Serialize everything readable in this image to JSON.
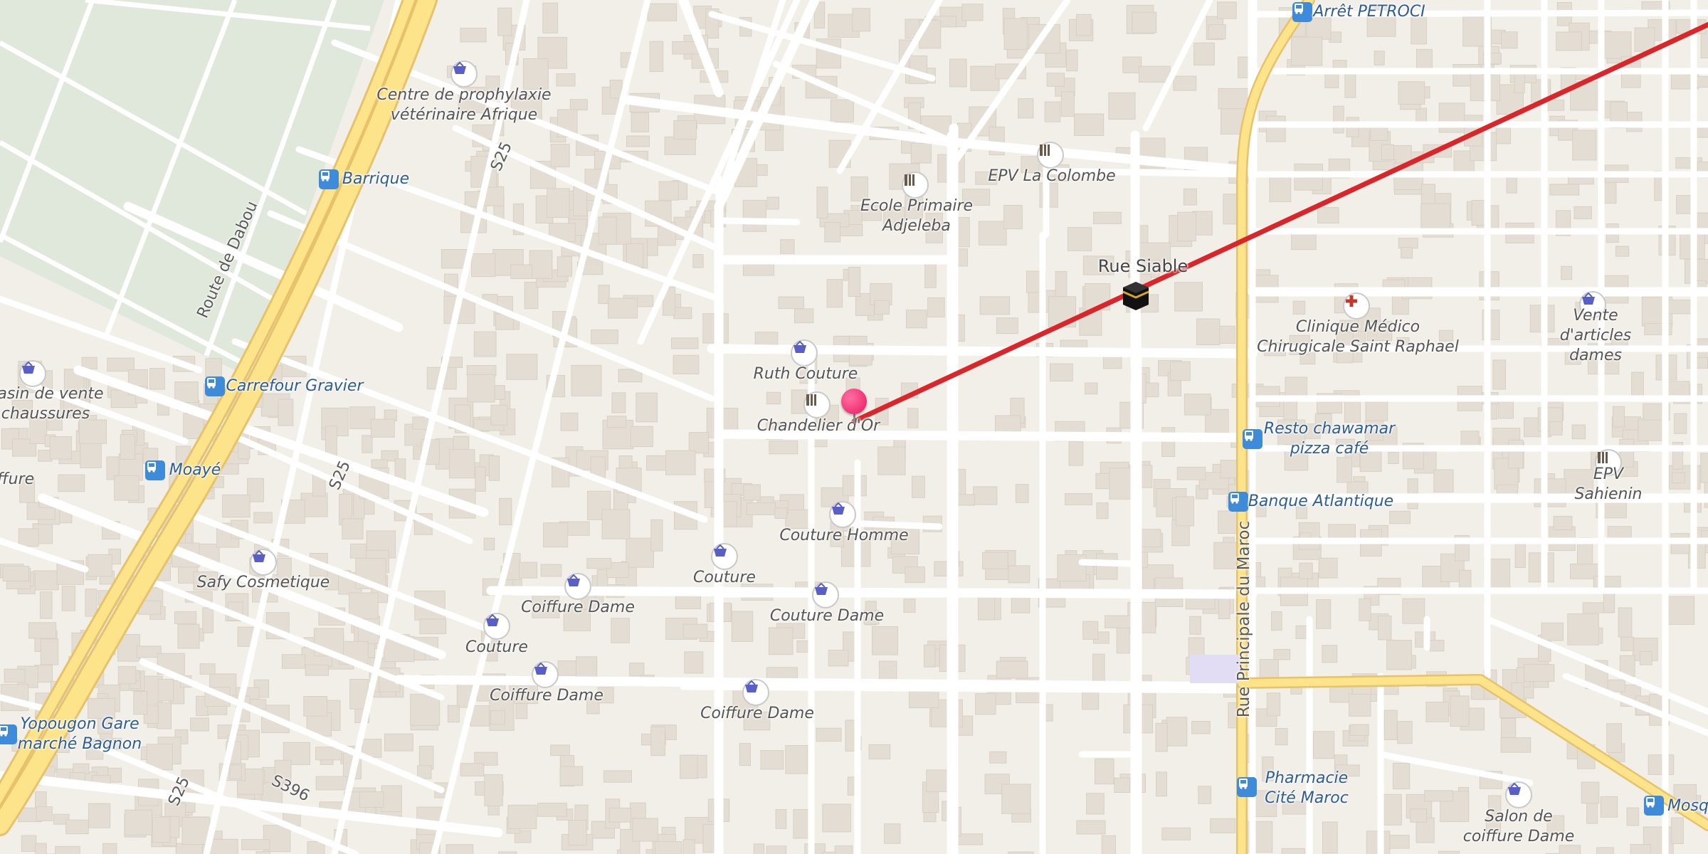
{
  "map": {
    "route_color": "#d9262b",
    "road_labels": [
      {
        "text": "Route de Dabou",
        "icon": "road-label"
      },
      {
        "text": "Rue Principale du Maroc",
        "icon": "road-label"
      },
      {
        "text": "S25",
        "icon": "road-label"
      },
      {
        "text": "S25",
        "icon": "road-label"
      },
      {
        "text": "S25",
        "icon": "road-label"
      },
      {
        "text": "S396",
        "icon": "road-label"
      }
    ],
    "pois": [
      {
        "label": "Centre de prophylaxie\nvétérinaire Afrique",
        "icon": "shop-basket-icon"
      },
      {
        "label": "Barrique",
        "icon": "bus-stop-icon"
      },
      {
        "label": "Carrefour Gravier",
        "icon": "bus-stop-icon"
      },
      {
        "label": "Moayé",
        "icon": "bus-stop-icon"
      },
      {
        "label": "gasin de vente\nchaussures",
        "icon": "shop-basket-icon"
      },
      {
        "label": "ffure",
        "icon": "shop-basket-icon"
      },
      {
        "label": "Safy Cosmetique",
        "icon": "shop-basket-icon"
      },
      {
        "label": "Yopougon Gare\nmarché Bagnon",
        "icon": "bus-stop-icon"
      },
      {
        "label": "Coiffure Dame",
        "icon": "shop-basket-icon"
      },
      {
        "label": "Couture",
        "icon": "shop-basket-icon"
      },
      {
        "label": "Coiffure Dame",
        "icon": "shop-basket-icon"
      },
      {
        "label": "Couture",
        "icon": "shop-basket-icon"
      },
      {
        "label": "Coiffure Dame",
        "icon": "shop-basket-icon"
      },
      {
        "label": "Couture Dame",
        "icon": "shop-basket-icon"
      },
      {
        "label": "Couture Homme",
        "icon": "shop-basket-icon"
      },
      {
        "label": "Ruth Couture",
        "icon": "shop-basket-icon"
      },
      {
        "label": "Chandelier d'Or",
        "icon": "school-icon"
      },
      {
        "label": "Ecole Primaire\nAdjeleba",
        "icon": "school-icon"
      },
      {
        "label": "EPV La Colombe",
        "icon": "school-icon"
      },
      {
        "label": "Rue Siable",
        "icon": "mosque-kaaba-icon"
      },
      {
        "label": "Arrêt PETROCI",
        "icon": "bus-stop-icon"
      },
      {
        "label": "Clinique Médico\nChirugicale Saint Raphael",
        "icon": "clinic-cross-icon"
      },
      {
        "label": "Vente d'articles\ndames",
        "icon": "shop-basket-icon"
      },
      {
        "label": "Resto chawamar\npizza café",
        "icon": "bus-stop-icon"
      },
      {
        "label": "Banque Atlantique",
        "icon": "bus-stop-icon"
      },
      {
        "label": "EPV Sahienin",
        "icon": "school-icon"
      },
      {
        "label": "Pharmacie\nCité Maroc",
        "icon": "bus-stop-icon"
      },
      {
        "label": "Salon de\ncoiffure Dame",
        "icon": "shop-basket-icon"
      },
      {
        "label": "Mosq",
        "icon": "bus-stop-icon"
      }
    ]
  }
}
